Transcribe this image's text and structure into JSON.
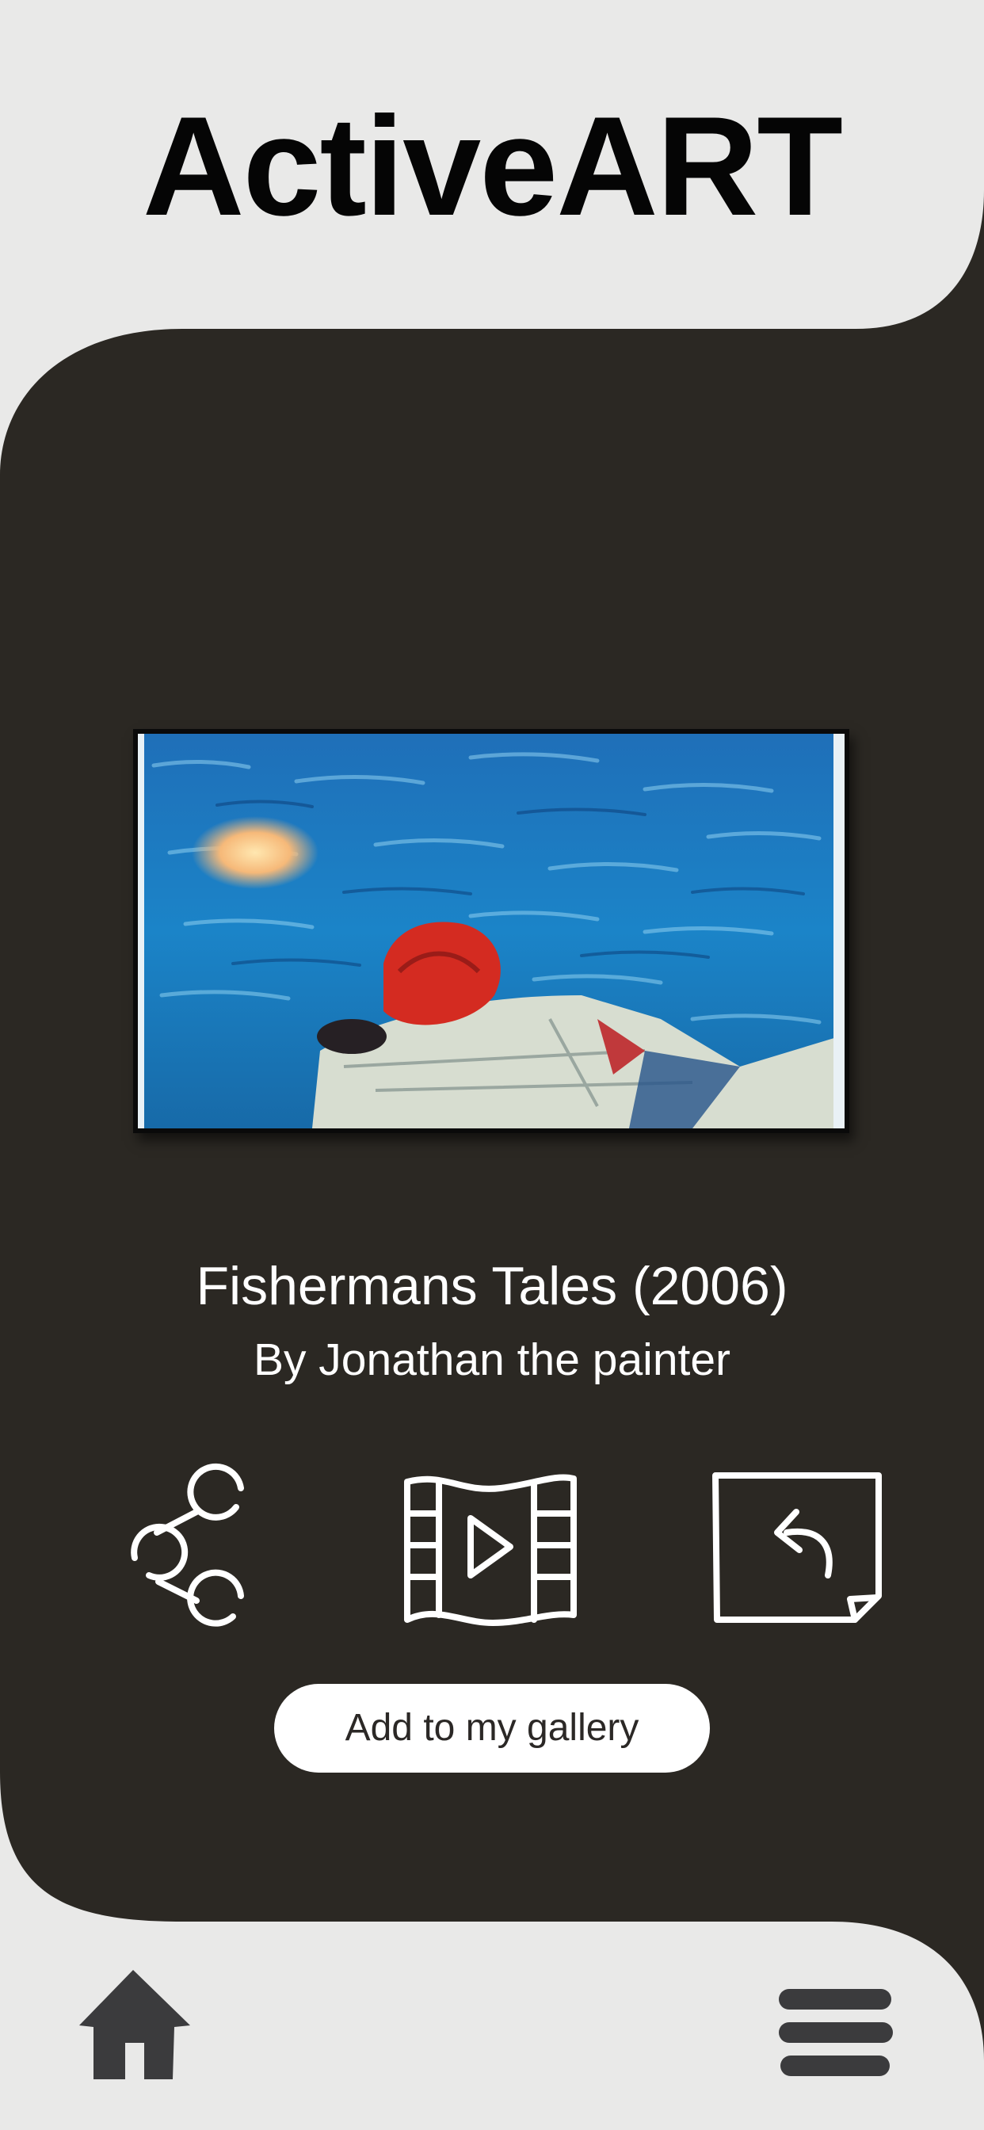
{
  "app": {
    "title": "ActiveART"
  },
  "artwork": {
    "title": "Fishermans Tales (2006)",
    "artist": "By Jonathan the painter"
  },
  "actions": {
    "share_icon": "share-icon",
    "video_icon": "video-film-icon",
    "return_icon": "return-page-icon",
    "add_to_gallery_label": "Add to my gallery"
  },
  "bottom_nav": {
    "home_icon": "home-icon",
    "menu_icon": "hamburger-menu-icon"
  },
  "colors": {
    "background": "#e9e9e8",
    "panel": "#2b2823",
    "title_text": "#050505",
    "panel_text": "#ffffff",
    "nav_icon": "#3b3b3d"
  }
}
